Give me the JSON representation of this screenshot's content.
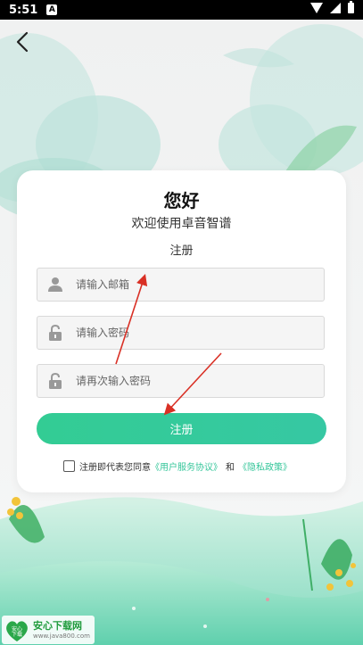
{
  "status_bar": {
    "time": "5:51",
    "notification_glyph": "A"
  },
  "header": {
    "back_icon": "chevron-left-icon"
  },
  "card": {
    "title": "您好",
    "subtitle": "欢迎使用卓音智谱",
    "section_label": "注册",
    "fields": [
      {
        "placeholder": "请输入邮箱",
        "icon": "user-icon"
      },
      {
        "placeholder": "请输入密码",
        "icon": "lock-icon"
      },
      {
        "placeholder": "请再次输入密码",
        "icon": "lock-icon"
      }
    ],
    "submit_label": "注册",
    "agreement": {
      "prefix": "注册即代表您同意",
      "terms_link": "《用户服务协议》",
      "conjunction": "和",
      "privacy_link": "《隐私政策》"
    }
  },
  "watermark": {
    "title": "安心下载网",
    "url": "www.java800.com",
    "logo_text": "安心\n下载"
  },
  "colors": {
    "accent": "#35c69a",
    "arrow": "#d93025"
  }
}
